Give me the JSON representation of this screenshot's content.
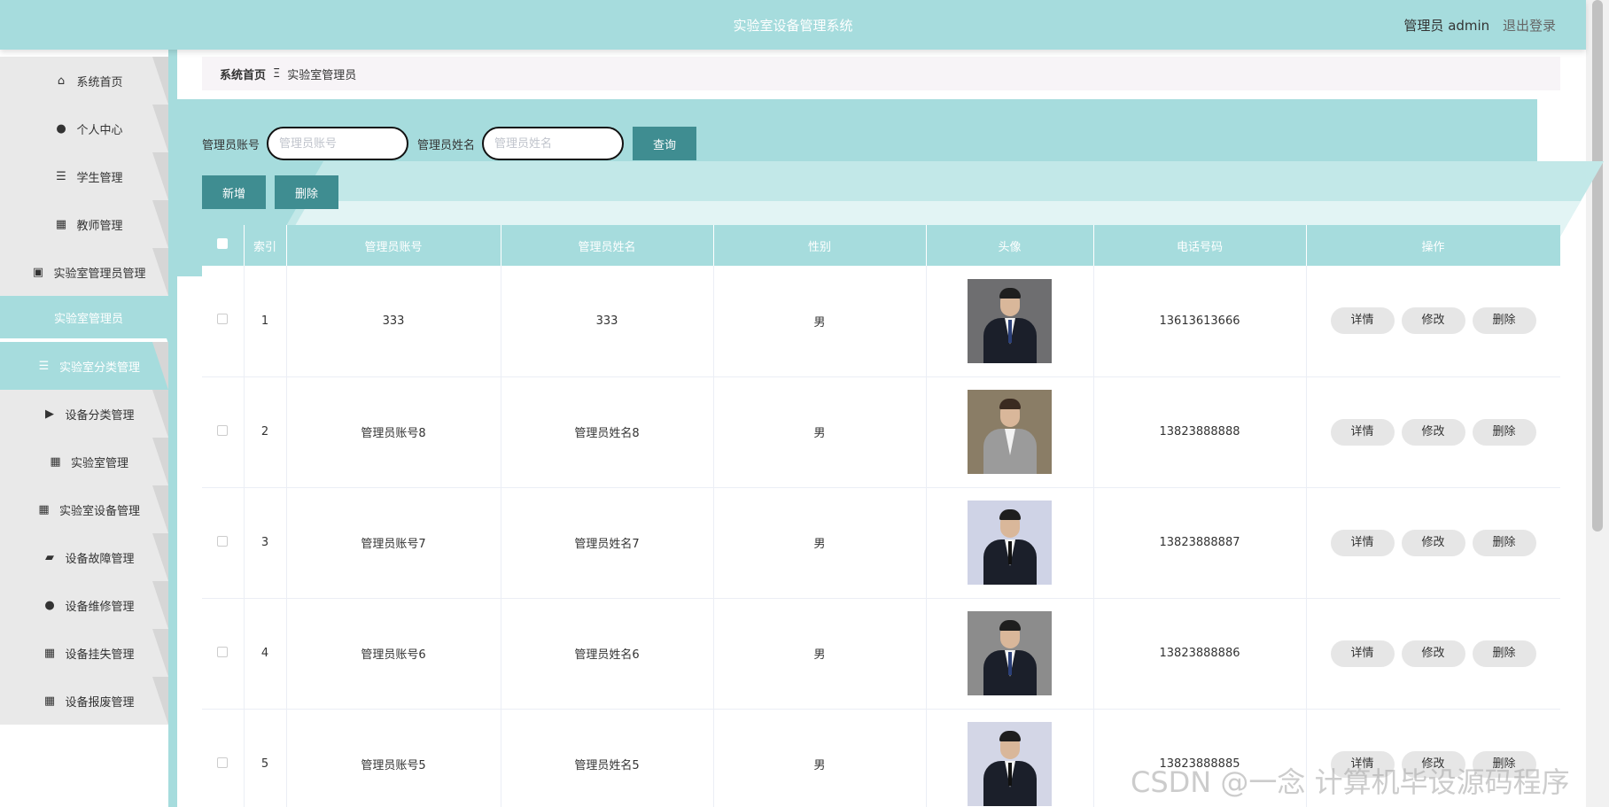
{
  "header": {
    "title": "实验室设备管理系统",
    "user_label": "管理员 admin",
    "logout": "退出登录"
  },
  "sidebar": {
    "items": [
      {
        "label": "系统首页",
        "icon": "home-icon"
      },
      {
        "label": "个人中心",
        "icon": "user-icon"
      },
      {
        "label": "学生管理",
        "icon": "list-icon"
      },
      {
        "label": "教师管理",
        "icon": "grid-icon"
      },
      {
        "label": "实验室管理员管理",
        "icon": "clipboard-icon"
      },
      {
        "label": "实验室管理员",
        "icon": ""
      },
      {
        "label": "实验室分类管理",
        "icon": "list-icon"
      },
      {
        "label": "设备分类管理",
        "icon": "video-icon"
      },
      {
        "label": "实验室管理",
        "icon": "grid-icon"
      },
      {
        "label": "实验室设备管理",
        "icon": "grid-icon"
      },
      {
        "label": "设备故障管理",
        "icon": "wallet-icon"
      },
      {
        "label": "设备维修管理",
        "icon": "user-icon"
      },
      {
        "label": "设备挂失管理",
        "icon": "grid-icon"
      },
      {
        "label": "设备报废管理",
        "icon": "grid-icon"
      }
    ]
  },
  "breadcrumb": {
    "home": "系统首页",
    "separator": "Ξ",
    "current": "实验室管理员"
  },
  "search": {
    "account_label": "管理员账号",
    "account_placeholder": "管理员账号",
    "name_label": "管理员姓名",
    "name_placeholder": "管理员姓名",
    "query_button": "查询"
  },
  "actions": {
    "add": "新增",
    "delete": "删除"
  },
  "table": {
    "columns": [
      "",
      "索引",
      "管理员账号",
      "管理员姓名",
      "性别",
      "头像",
      "电话号码",
      "操作"
    ],
    "rows": [
      {
        "index": "1",
        "account": "333",
        "name": "333",
        "gender": "男",
        "phone": "13613613666"
      },
      {
        "index": "2",
        "account": "管理员账号8",
        "name": "管理员姓名8",
        "gender": "男",
        "phone": "13823888888"
      },
      {
        "index": "3",
        "account": "管理员账号7",
        "name": "管理员姓名7",
        "gender": "男",
        "phone": "13823888887"
      },
      {
        "index": "4",
        "account": "管理员账号6",
        "name": "管理员姓名6",
        "gender": "男",
        "phone": "13823888886"
      },
      {
        "index": "5",
        "account": "管理员账号5",
        "name": "管理员姓名5",
        "gender": "男",
        "phone": "13823888885"
      }
    ],
    "row_actions": {
      "detail": "详情",
      "edit": "修改",
      "delete": "删除"
    }
  },
  "watermark": "CSDN @一念 计算机毕设源码程序",
  "colors": {
    "accent": "#a6dcdd",
    "button": "#3f8d91",
    "menu_bg": "#e9e9e9"
  }
}
